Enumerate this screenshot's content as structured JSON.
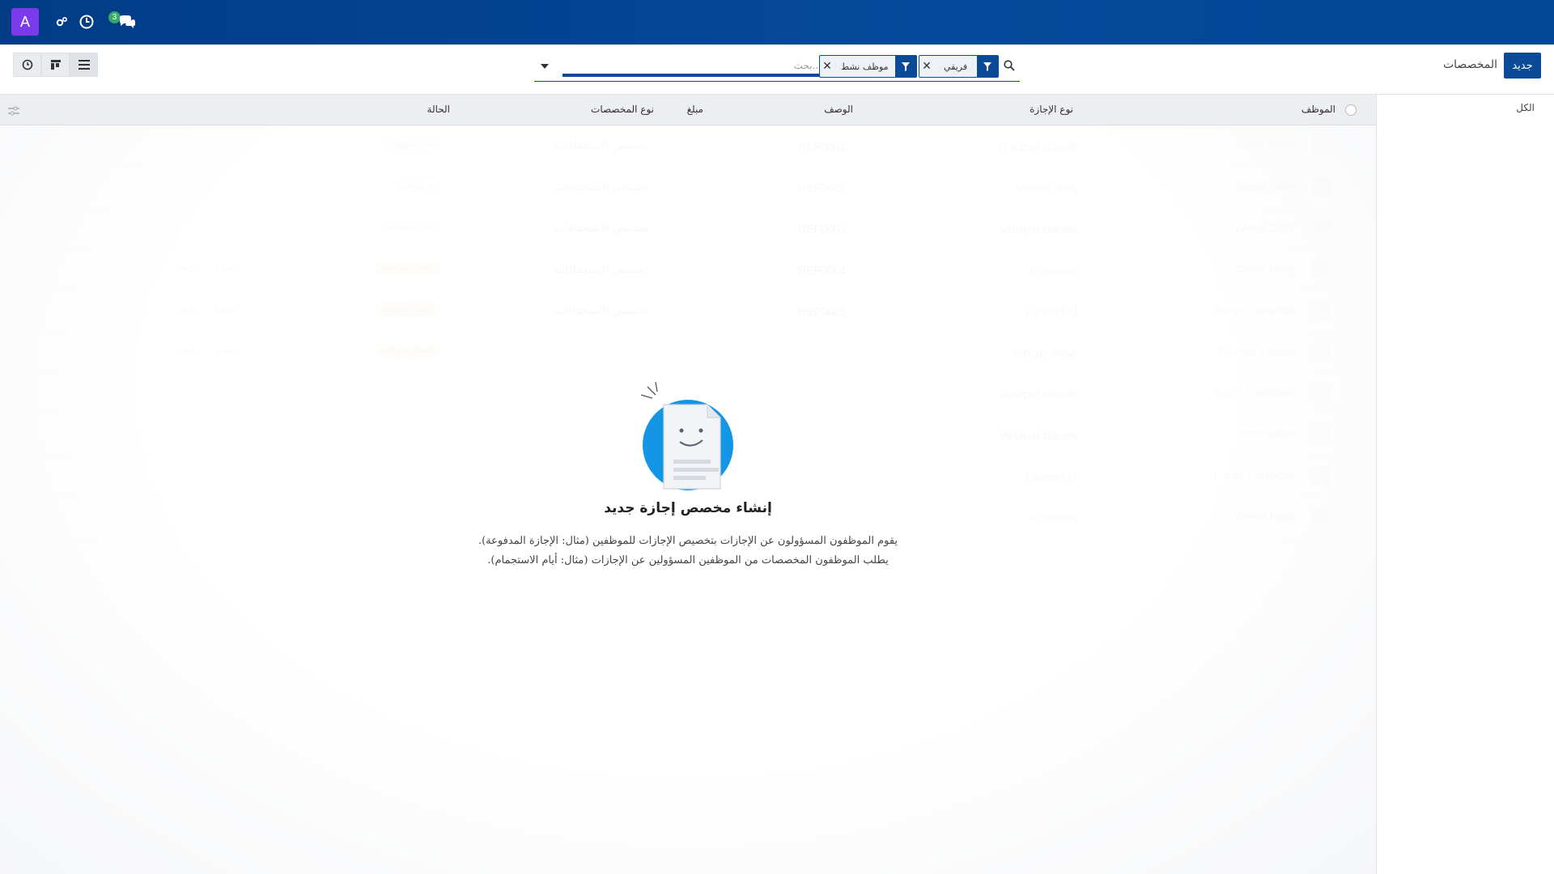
{
  "navbar": {
    "avatar_letter": "A",
    "messages_count": "3",
    "icons": [
      "settings-icon",
      "clock-icon",
      "chat-icon"
    ]
  },
  "control": {
    "new_button": "جديد",
    "breadcrumb": "المخصصات",
    "search_placeholder": "بحث...",
    "facets": [
      "فريقي",
      "موظف نشط"
    ]
  },
  "side_panel": {
    "items": [
      "الكل"
    ]
  },
  "table": {
    "columns": [
      "الموظف",
      "نوع الإجازة",
      "الوصف",
      "مبلغ",
      "نوع المخصصات",
      "الحالة"
    ],
    "rows": [
      {
        "employee": "John Miller",
        "leave_type": "Volutpat blandit",
        "description": "REF0001",
        "kind": "تخصيص الاستحقاقات",
        "state": "تمت الموافقة",
        "state_style": "plain"
      },
      {
        "employee": "Carrie Helle",
        "leave_type": "Viverra nam",
        "description": "REF0002",
        "kind": "تخصيص الاستحقاقات",
        "state": "تم الرفض",
        "state_style": "plain"
      },
      {
        "employee": "Wendi Baltz",
        "leave_type": "Volutpat blandit",
        "description": "REF0003",
        "kind": "تخصيص الاستحقاقات",
        "state": "تمت الموافقة",
        "state_style": "plain"
      },
      {
        "employee": "Carrie Helle",
        "leave_type": "In massa",
        "description": "REF0004",
        "kind": "تخصيص الاستحقاقات",
        "state": "بانتظار الموافقة",
        "state_style": "warn",
        "validate": "تصديق",
        "refuse": "رفض"
      },
      {
        "employee": "Henry Campbell",
        "leave_type": "Laoreet id",
        "description": "REF0005",
        "kind": "تخصيص الاستحقاقات",
        "state": "بانتظار الموافقة",
        "state_style": "warn",
        "validate": "تصديق",
        "refuse": "رفض"
      },
      {
        "employee": "Thomas Passot",
        "leave_type": "Integer vitae",
        "description": "",
        "kind": "",
        "state": "بانتظار الموافقة",
        "state_style": "warn",
        "validate": "تصديق",
        "refuse": "رفض"
      },
      {
        "employee": "Henry Campbell",
        "leave_type": "Volutpat blandit",
        "description": "",
        "kind": "",
        "state": "",
        "state_style": "plain"
      },
      {
        "employee": "John Miller",
        "leave_type": "Volutpat blandit",
        "description": "",
        "kind": "",
        "state": "",
        "state_style": "plain"
      },
      {
        "employee": "Henry Campbell",
        "leave_type": "Laoreet id",
        "description": "",
        "kind": "",
        "state": "",
        "state_style": "plain"
      },
      {
        "employee": "Wendi Baltz",
        "leave_type": "In massa",
        "description": "",
        "kind": "",
        "state": "",
        "state_style": "plain"
      }
    ]
  },
  "helper": {
    "title": "إنشاء مخصص إجازة جديد",
    "line1": "يقوم الموظفون المسؤولون عن الإجازات بتخصيص الإجازات للموظفين (مثال: الإجازة المدفوعة).",
    "line2": "يطلب الموظفون المخصصات من الموظفين المسؤولين عن الإجازات (مثال: أيام الاستجمام)."
  },
  "colors": {
    "navbar": "#023c86",
    "primary": "#0a4a96",
    "avatar": "#7c3aed",
    "badge": "#39a96b"
  }
}
